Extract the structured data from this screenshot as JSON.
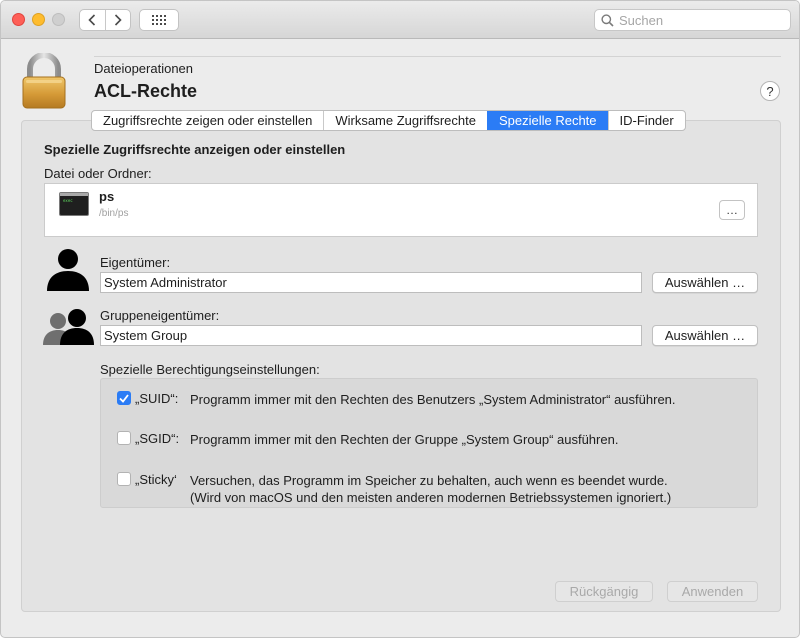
{
  "toolbar": {
    "search_placeholder": "Suchen"
  },
  "header": {
    "subtitle": "Dateioperationen",
    "title": "ACL-Rechte",
    "help_label": "?"
  },
  "tabs": [
    {
      "label": "Zugriffsrechte zeigen oder einstellen",
      "active": false
    },
    {
      "label": "Wirksame Zugriffsrechte",
      "active": false
    },
    {
      "label": "Spezielle Rechte",
      "active": true
    },
    {
      "label": "ID-Finder",
      "active": false
    }
  ],
  "main": {
    "section_title": "Spezielle Zugriffsrechte anzeigen oder einstellen",
    "file_label": "Datei oder Ordner:",
    "file": {
      "name": "ps",
      "path": "/bin/ps",
      "icon_text": "exec",
      "more_label": "…"
    },
    "owner": {
      "label": "Eigentümer:",
      "value": "System Administrator",
      "button": "Auswählen …"
    },
    "group": {
      "label": "Gruppeneigentümer:",
      "value": "System Group",
      "button": "Auswählen …"
    },
    "special_label": "Spezielle Berechtigungseinstellungen:",
    "permissions": [
      {
        "label": "„SUID“:",
        "checked": true,
        "lines": [
          "Programm immer mit den Rechten des Benutzers „System Administrator“ ausführen."
        ]
      },
      {
        "label": "„SGID“:",
        "checked": false,
        "lines": [
          "Programm immer mit den Rechten der Gruppe „System Group“ ausführen."
        ]
      },
      {
        "label": "„Sticky‘",
        "checked": false,
        "lines": [
          "Versuchen, das Programm im Speicher zu behalten, auch wenn es beendet wurde.",
          "(Wird von macOS und den meisten anderen modernen Betriebssystemen ignoriert.)"
        ]
      }
    ]
  },
  "footer": {
    "revert": "Rückgängig",
    "apply": "Anwenden"
  },
  "colors": {
    "accent": "#2b7cf5",
    "window_bg": "#ececec",
    "panel_bg": "#e3e3e3"
  }
}
